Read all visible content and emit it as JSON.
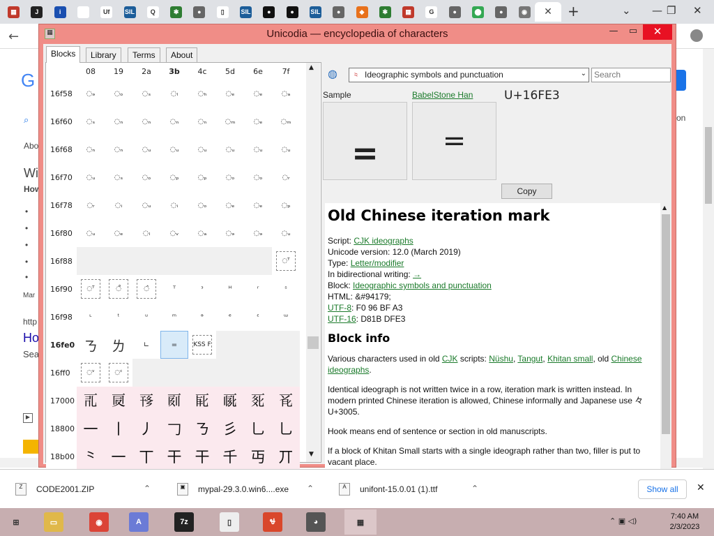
{
  "browser": {
    "tabs": [
      {
        "icon": "unicode-red-icon",
        "color": "#c0392b",
        "glyph": "▦"
      },
      {
        "icon": "black-logo-icon",
        "color": "#222222",
        "glyph": "J"
      },
      {
        "icon": "info-icon",
        "color": "#1a4fb0",
        "glyph": "i"
      },
      {
        "icon": "blank-tab-icon",
        "color": "#ffffff",
        "glyph": ""
      },
      {
        "icon": "uf-icon",
        "color": "#ffffff",
        "glyph": "Uf"
      },
      {
        "icon": "sil-icon",
        "color": "#1c5d99",
        "glyph": "SIL"
      },
      {
        "icon": "q-icon",
        "color": "#ffffff",
        "glyph": "Q"
      },
      {
        "icon": "puzzle-icon",
        "color": "#2e7d32",
        "glyph": "✱"
      },
      {
        "icon": "globe-icon",
        "color": "#666666",
        "glyph": "●"
      },
      {
        "icon": "page-icon",
        "color": "#ffffff",
        "glyph": "▯"
      },
      {
        "icon": "sil-icon",
        "color": "#1c5d99",
        "glyph": "SIL"
      },
      {
        "icon": "black-circle-icon",
        "color": "#111111",
        "glyph": "●"
      },
      {
        "icon": "black-circle-icon",
        "color": "#111111",
        "glyph": "●"
      },
      {
        "icon": "sil-icon",
        "color": "#1c5d99",
        "glyph": "SIL"
      },
      {
        "icon": "globe-icon",
        "color": "#666666",
        "glyph": "●"
      },
      {
        "icon": "diamond-icon",
        "color": "#e8711c",
        "glyph": "◆"
      },
      {
        "icon": "puzzle-icon",
        "color": "#2e7d32",
        "glyph": "✱"
      },
      {
        "icon": "unicode-red-icon",
        "color": "#c0392b",
        "glyph": "▦"
      },
      {
        "icon": "google-icon",
        "color": "#ffffff",
        "glyph": "G"
      },
      {
        "icon": "globe-icon",
        "color": "#666666",
        "glyph": "●"
      },
      {
        "icon": "maps-pin-icon",
        "color": "#34a853",
        "glyph": "⬤"
      },
      {
        "icon": "globe-icon",
        "color": "#666666",
        "glyph": "●"
      },
      {
        "icon": "chrome-icon",
        "color": "#777777",
        "glyph": "◉"
      }
    ],
    "active_tab_close": "✕",
    "new_tab": "+",
    "tab_search": "⌄",
    "window_controls": [
      "—",
      "❐",
      "✕"
    ],
    "nav_back": "←",
    "page_fragments": {
      "logo_letter": "G",
      "abo": "Abo",
      "wi": "Wi",
      "how": "How",
      "bullets": [
        "•",
        "•",
        "•",
        "•",
        "•"
      ],
      "mar": "Mar",
      "http": "http",
      "ho": "Ho",
      "sea": "Sea",
      "on": "on"
    }
  },
  "app": {
    "title": "Unicodia — encyclopedia of characters",
    "tabs": [
      "Blocks",
      "Library",
      "Terms",
      "About"
    ],
    "grid": {
      "columns": [
        "08",
        "19",
        "2a",
        "3b",
        "4c",
        "5d",
        "6e",
        "7f"
      ],
      "bold_column": 3,
      "rows": [
        {
          "label": "16f58",
          "cells": [
            "◌ₔ",
            "◌ₒ",
            "◌ₛ",
            "◌ₗ",
            "◌ₕ",
            "◌ₑ",
            "◌ₑ",
            "◌ₐ"
          ]
        },
        {
          "label": "16f60",
          "cells": [
            "◌ₛ",
            "◌ₙ",
            "◌ₙ",
            "◌ₙ",
            "◌ₙ",
            "◌ₘ",
            "◌ₑ",
            "◌ₘ"
          ]
        },
        {
          "label": "16f68",
          "cells": [
            "◌ₙ",
            "◌ₙ",
            "◌ᵤ",
            "◌ᵤ",
            "◌ᵤ",
            "◌ᵤ",
            "◌ᵤ",
            "◌ᵤ"
          ]
        },
        {
          "label": "16f70",
          "cells": [
            "◌ᵤ",
            "◌ₛ",
            "◌ₒ",
            "◌ₚ",
            "◌ₚ",
            "◌ₒ",
            "◌ₒ",
            "◌ᵣ"
          ]
        },
        {
          "label": "16f78",
          "cells": [
            "◌ᵣ",
            "◌ᵢ",
            "◌ᵤ",
            "◌ᵢ",
            "◌ₒ",
            "◌ₑ",
            "◌ₑ",
            "◌ₚ"
          ]
        },
        {
          "label": "16f80",
          "cells": [
            "◌ᵤ",
            "◌ₑ",
            "◌ₗ",
            "◌ᵥ",
            "◌ₐ",
            "◌ₔ",
            "◌ₔ",
            "◌ᵤ"
          ]
        },
        {
          "label": "16f88",
          "cells": [
            "",
            "",
            "",
            "",
            "",
            "",
            "",
            "◌ᵀ"
          ]
        },
        {
          "label": "16f90",
          "cells": [
            "◌ᵀ",
            "◌̊",
            "◌̂",
            "ᵀ",
            "ᵌ",
            "ᴴ",
            "ʳ",
            "ˢ"
          ]
        },
        {
          "label": "16f98",
          "cells": [
            "ᶫ",
            "ᵗ",
            "ᵘ",
            "ᵐ",
            "ᵊ",
            "ᵉ",
            "ᵋ",
            "ᵚ"
          ]
        },
        {
          "label": "16fe0",
          "cells": [
            "ㄋ",
            "ㄌ",
            "∟",
            "=",
            "KSS F",
            "",
            "",
            ""
          ]
        },
        {
          "label": "16ff0",
          "cells": [
            "◌ᵛ",
            "◌ᶜ",
            "",
            "",
            "",
            "",
            "",
            ""
          ]
        },
        {
          "label": "17000",
          "cells": [
            "𗀀",
            "𗀁",
            "𗀂",
            "𗀃",
            "𗀄",
            "𗀅",
            "𗀆",
            "𗀇"
          ]
        },
        {
          "label": "18800",
          "cells": [
            "一",
            "丨",
            "丿",
            "𠃌",
            "ㄋ",
            "彡",
            "乚",
            "乚"
          ]
        },
        {
          "label": "18b00",
          "cells": [
            "⺀",
            "一",
            "丅",
            "干",
            "干",
            "千",
            "丏",
            "丌"
          ]
        }
      ],
      "bold_row": 9,
      "selected": {
        "row": 9,
        "col": 3
      }
    },
    "block_select": "Ideographic symbols and punctuation",
    "search_placeholder": "Search",
    "sample_label": "Sample",
    "font_link": "BabelStone Han",
    "codepoint": "U+16FE3",
    "sample_glyph": "=",
    "font_glyph": "=",
    "copy_button": "Copy",
    "info": {
      "char_name": "Old Chinese iteration mark",
      "script_label": "Script:",
      "script_value": "CJK ideographs",
      "version_text": "Unicode version: 12.0 (March 2019)",
      "type_label": "Type:",
      "type_value": "Letter/modifier",
      "bidi_label": "In bidirectional writing:",
      "bidi_value": "→",
      "block_label": "Block:",
      "block_value": "Ideographic symbols and punctuation",
      "html_text": "HTML: &#94179;",
      "utf8_label": "UTF-8",
      "utf8_value": ": F0 96 BF A3",
      "utf16_label": "UTF-16",
      "utf16_value": ": D81B DFE3",
      "block_info_heading": "Block info",
      "para1_a": "Various characters used in old",
      "para1_cjk": "CJK",
      "para1_b": "scripts:",
      "para1_nushu": "Nüshu",
      "para1_tangut": "Tangut",
      "para1_khitan": "Khitan small",
      "para1_c": ", old",
      "para1_chinese": "Chinese ideographs",
      "para2": "Identical ideograph is not written twice in a row, iteration mark is written instead. In modern printed Chinese iteration is allowed, Chinese informally and Japanese use 々 U+3005.",
      "para3": "Hook means end of sentence or section in old manuscripts.",
      "para4": "If a block of Khitan Small starts with a single ideograph rather than two, filler is put to vacant place."
    }
  },
  "downloads": {
    "items": [
      {
        "name": "CODE2001.ZIP",
        "chevron": "⌃"
      },
      {
        "name": "mypal-29.3.0.win6....exe",
        "chevron": "⌃"
      },
      {
        "name": "unifont-15.0.01 (1).ttf",
        "chevron": "⌃"
      }
    ],
    "show_all": "Show all",
    "close": "✕"
  },
  "taskbar": {
    "apps": [
      {
        "icon": "windows-start-icon",
        "color": "#c7aeb0",
        "glyph": "⊞"
      },
      {
        "icon": "file-explorer-icon",
        "color": "#e0b84a",
        "glyph": "▭"
      },
      {
        "icon": "chrome-icon",
        "color": "#db4437",
        "glyph": "◉"
      },
      {
        "icon": "font-app-icon",
        "color": "#6b7bd6",
        "glyph": "A"
      },
      {
        "icon": "7zip-icon",
        "color": "#222222",
        "glyph": "7z"
      },
      {
        "icon": "document-icon",
        "color": "#eeeeee",
        "glyph": "▯"
      },
      {
        "icon": "red-app-icon",
        "color": "#d9472b",
        "glyph": "Ꮰ"
      },
      {
        "icon": "raccoon-icon",
        "color": "#555555",
        "glyph": "◕"
      },
      {
        "icon": "unicodia-icon",
        "color": "#dcc7c9",
        "glyph": "▦"
      }
    ],
    "tray": "⌃  ▣  ◁)",
    "time": "7:40 AM",
    "date": "2/3/2023"
  }
}
